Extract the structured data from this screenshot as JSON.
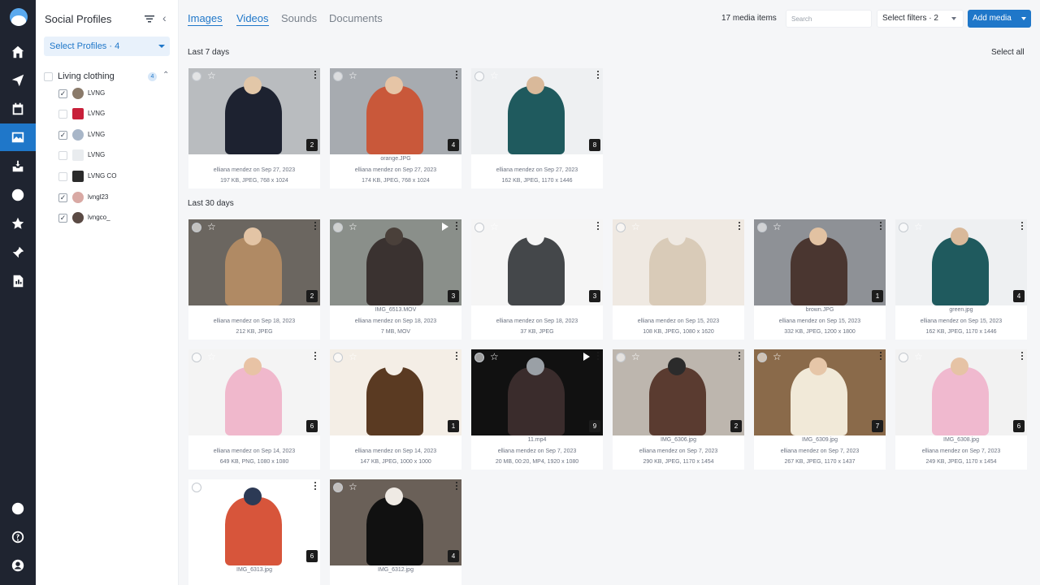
{
  "sidebar": {
    "title": "Social Profiles",
    "select_profiles": "Select Profiles · 4",
    "group": {
      "name": "Living clothing",
      "count": "4"
    },
    "profiles": [
      {
        "name": "LVNG",
        "checked": true
      },
      {
        "name": "LVNG",
        "checked": false
      },
      {
        "name": "LVNG",
        "checked": true
      },
      {
        "name": "LVNG",
        "checked": false
      },
      {
        "name": "LVNG CO",
        "checked": false
      },
      {
        "name": "lvngl23",
        "checked": true
      },
      {
        "name": "lvngco_",
        "checked": true
      }
    ]
  },
  "tabs": [
    "Images",
    "Videos",
    "Sounds",
    "Documents"
  ],
  "header": {
    "media_count": "17 media items",
    "search_placeholder": "Search",
    "filters": "Select filters · 2",
    "add_media": "Add media"
  },
  "sections": {
    "last7": "Last 7 days",
    "last30": "Last 30 days",
    "select_all": "Select all"
  },
  "cards": [
    {
      "badge": "2",
      "filename": "",
      "meta1": "elliana mendez on Sep 27, 2023",
      "meta2": "197 KB, JPEG, 768 x 1024",
      "video": false
    },
    {
      "badge": "4",
      "filename": "orange.JPG",
      "meta1": "elliana mendez on Sep 27, 2023",
      "meta2": "174 KB, JPEG, 768 x 1024",
      "video": false
    },
    {
      "badge": "8",
      "filename": "",
      "meta1": "elliana mendez on Sep 27, 2023",
      "meta2": "162 KB, JPEG, 1170 x 1446",
      "video": false
    },
    {
      "badge": "2",
      "filename": "",
      "meta1": "elliana mendez on Sep 18, 2023",
      "meta2": "212 KB, JPEG",
      "video": false
    },
    {
      "badge": "3",
      "filename": "IMG_6513.MOV",
      "meta1": "elliana mendez on Sep 18, 2023",
      "meta2": "7 MB, MOV",
      "video": true
    },
    {
      "badge": "3",
      "filename": "",
      "meta1": "elliana mendez on Sep 18, 2023",
      "meta2": "37 KB, JPEG",
      "video": false
    },
    {
      "badge": "",
      "filename": "",
      "meta1": "elliana mendez on Sep 15, 2023",
      "meta2": "108 KB, JPEG, 1080 x 1620",
      "video": false
    },
    {
      "badge": "1",
      "filename": "brown.JPG",
      "meta1": "elliana mendez on Sep 15, 2023",
      "meta2": "332 KB, JPEG, 1200 x 1800",
      "video": false
    },
    {
      "badge": "4",
      "filename": "green.jpg",
      "meta1": "elliana mendez on Sep 15, 2023",
      "meta2": "162 KB, JPEG, 1170 x 1446",
      "video": false
    },
    {
      "badge": "6",
      "filename": "",
      "meta1": "elliana mendez on Sep 14, 2023",
      "meta2": "649 KB, PNG, 1080 x 1080",
      "video": false
    },
    {
      "badge": "1",
      "filename": "",
      "meta1": "elliana mendez on Sep 14, 2023",
      "meta2": "147 KB, JPEG, 1000 x 1000",
      "video": false
    },
    {
      "badge": "9",
      "filename": "11.mp4",
      "meta1": "elliana mendez on Sep 7, 2023",
      "meta2": "20 MB, 00:20, MP4, 1920 x 1080",
      "video": true
    },
    {
      "badge": "2",
      "filename": "IMG_6306.jpg",
      "meta1": "elliana mendez on Sep 7, 2023",
      "meta2": "290 KB, JPEG, 1170 x 1454",
      "video": false
    },
    {
      "badge": "7",
      "filename": "IMG_6309.jpg",
      "meta1": "elliana mendez on Sep 7, 2023",
      "meta2": "267 KB, JPEG, 1170 x 1437",
      "video": false
    },
    {
      "badge": "6",
      "filename": "IMG_6308.jpg",
      "meta1": "elliana mendez on Sep 7, 2023",
      "meta2": "249 KB, JPEG, 1170 x 1454",
      "video": false
    },
    {
      "badge": "6",
      "filename": "IMG_6313.jpg",
      "meta1": "",
      "meta2": "",
      "video": false
    },
    {
      "badge": "4",
      "filename": "IMG_6312.jpg",
      "meta1": "",
      "meta2": "",
      "video": false
    }
  ],
  "colors": {
    "accent": "#1f77c9",
    "rail": "#1f2430"
  }
}
